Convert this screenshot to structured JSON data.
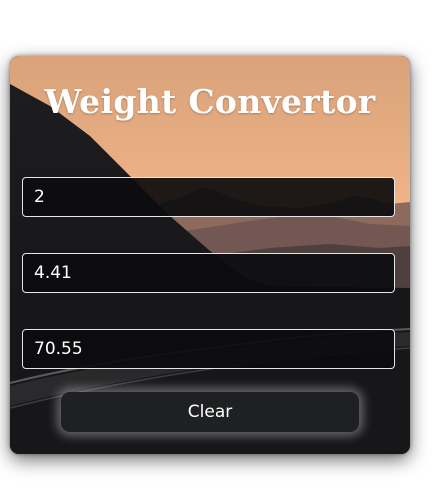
{
  "app": {
    "title": "Weight Convertor"
  },
  "fields": {
    "first_value": "2",
    "second_value": "4.41",
    "third_value": "70.55"
  },
  "actions": {
    "clear_label": "Clear"
  },
  "colors": {
    "sky_top": "#e0a77a",
    "sky_horizon": "#f3b98c",
    "input_bg": "#0c0c0e",
    "input_border": "#e6e6e6",
    "button_bg": "#1f2022",
    "text": "#ffffff"
  }
}
